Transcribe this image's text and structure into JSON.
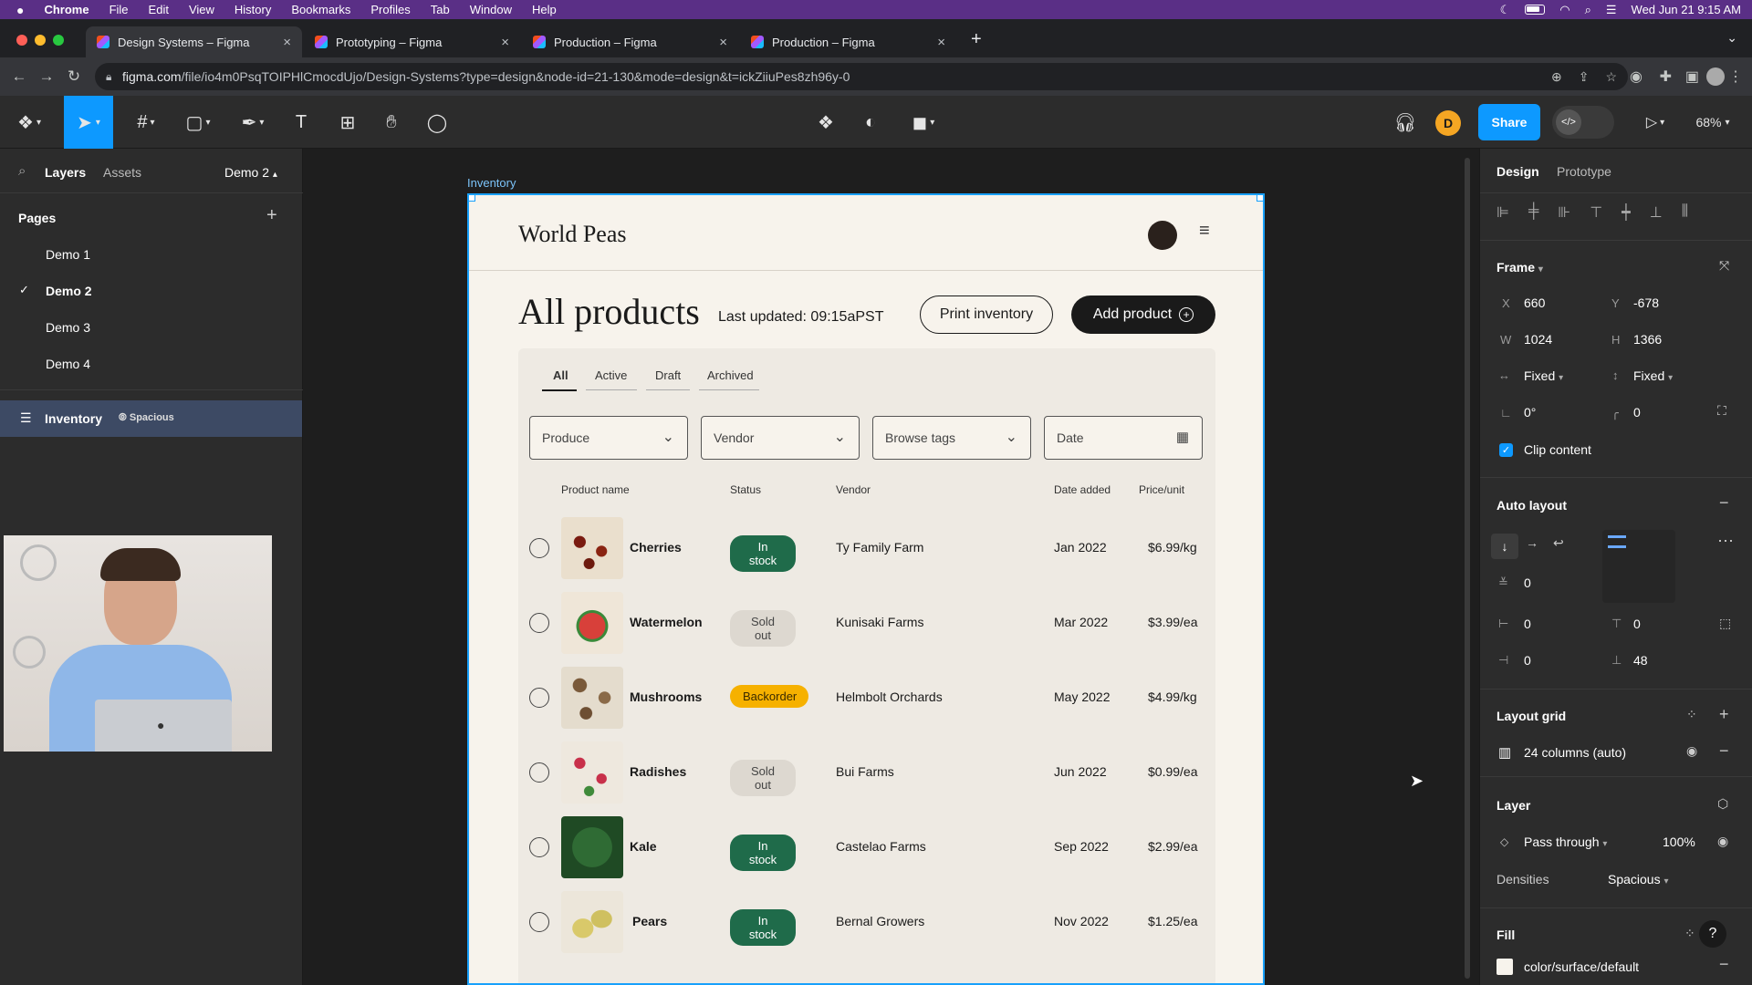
{
  "menubar": {
    "apple": "",
    "items": [
      "Chrome",
      "File",
      "Edit",
      "View",
      "History",
      "Bookmarks",
      "Profiles",
      "Tab",
      "Window",
      "Help"
    ],
    "clock": "Wed Jun 21  9:15 AM"
  },
  "browser": {
    "tabs": [
      {
        "title": "Design Systems – Figma"
      },
      {
        "title": "Prototyping – Figma"
      },
      {
        "title": "Production – Figma"
      },
      {
        "title": "Production – Figma"
      }
    ],
    "url_host": "figma.com",
    "url_path": "/file/io4m0PsqTOIPHlCmocdUjo/Design-Systems?type=design&node-id=21-130&mode=design&t=ickZiiuPes8zh96y-0"
  },
  "figma": {
    "avatar_letter": "D",
    "share_label": "Share",
    "zoom": "68%"
  },
  "leftpanel": {
    "tab_layers": "Layers",
    "tab_assets": "Assets",
    "page_selector": "Demo 2",
    "pages_heading": "Pages",
    "pages": [
      "Demo 1",
      "Demo 2",
      "Demo 3",
      "Demo 4"
    ],
    "current_page_check": "✓",
    "layer_name": "Inventory",
    "layer_mode": "Spacious"
  },
  "canvas": {
    "frame_label": "Inventory"
  },
  "app": {
    "brand": "World Peas",
    "heading": "All products",
    "last_updated": "Last updated: 09:15aPST",
    "print_label": "Print inventory",
    "add_label": "Add product",
    "filter_tabs": [
      "All",
      "Active",
      "Draft",
      "Archived"
    ],
    "filters": {
      "produce": "Produce",
      "vendor": "Vendor",
      "tags": "Browse tags",
      "date": "Date"
    },
    "columns": {
      "name": "Product name",
      "status": "Status",
      "vendor": "Vendor",
      "date": "Date added",
      "price": "Price/unit"
    },
    "rows": [
      {
        "name": "Cherries",
        "status": "In stock",
        "vendor": "Ty Family Farm",
        "date": "Jan 2022",
        "price": "$6.99/kg"
      },
      {
        "name": "Watermelon",
        "status": "Sold out",
        "vendor": "Kunisaki Farms",
        "date": "Mar 2022",
        "price": "$3.99/ea"
      },
      {
        "name": "Mushrooms",
        "status": "Backorder",
        "vendor": "Helmbolt Orchards",
        "date": "May 2022",
        "price": "$4.99/kg"
      },
      {
        "name": "Radishes",
        "status": "Sold out",
        "vendor": "Bui Farms",
        "date": "Jun 2022",
        "price": "$0.99/ea"
      },
      {
        "name": "Kale",
        "status": "In stock",
        "vendor": "Castelao Farms",
        "date": "Sep 2022",
        "price": "$2.99/ea"
      },
      {
        "name": "Pears",
        "status": "In stock",
        "vendor": "Bernal Growers",
        "date": "Nov 2022",
        "price": "$1.25/ea"
      }
    ]
  },
  "rightpanel": {
    "tab_design": "Design",
    "tab_prototype": "Prototype",
    "frame_title": "Frame",
    "x_label": "X",
    "x": "660",
    "y_label": "Y",
    "y": "-678",
    "w_label": "W",
    "w": "1024",
    "h_label": "H",
    "h": "1366",
    "w_mode": "Fixed",
    "h_mode": "Fixed",
    "rotation": "0°",
    "radius": "0",
    "clip_content": "Clip content",
    "auto_layout_title": "Auto layout",
    "spacing": "0",
    "pad_left": "0",
    "pad_top": "0",
    "pad_right": "0",
    "pad_bottom": "48",
    "layout_grid_title": "Layout grid",
    "grid_value": "24 columns (auto)",
    "layer_title": "Layer",
    "blend": "Pass through",
    "opacity": "100%",
    "densities_label": "Densities",
    "densities_value": "Spacious",
    "fill_title": "Fill",
    "fill_value": "color/surface/default",
    "help": "?"
  }
}
